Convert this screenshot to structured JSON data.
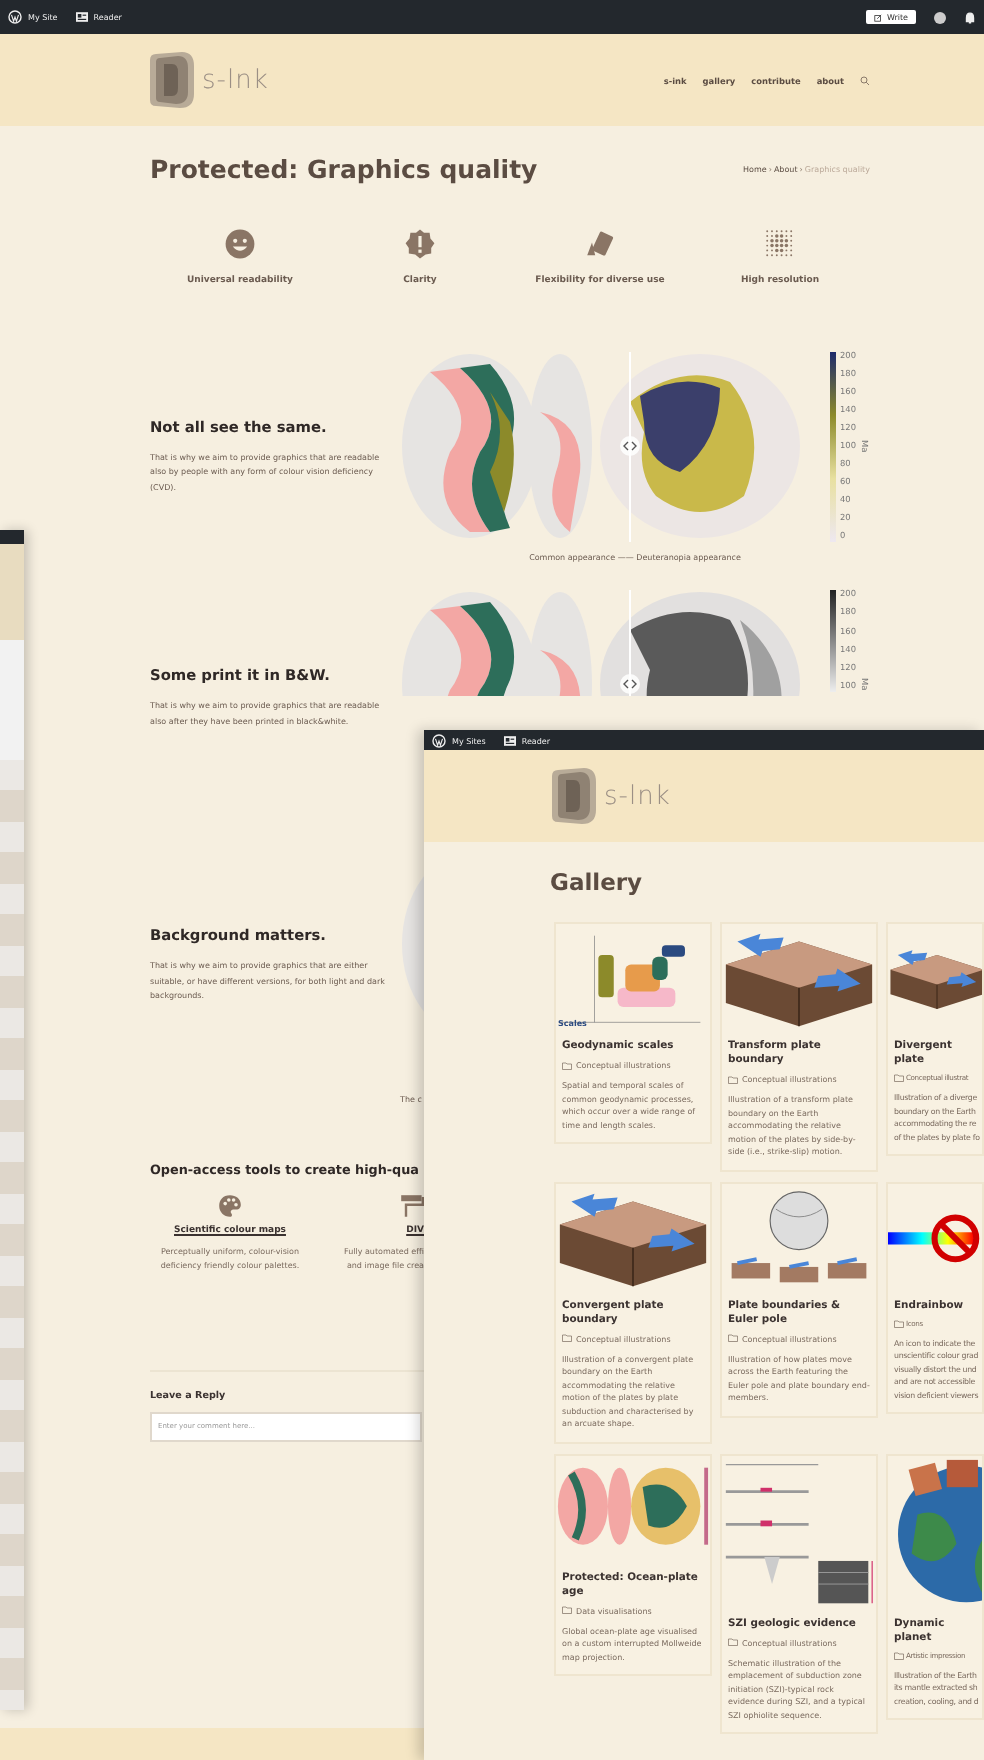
{
  "main_window": {
    "admin_bar": {
      "links": [
        "My Site",
        "Reader"
      ],
      "write_button": "Write"
    },
    "header": {
      "logo_text": "s-lnk",
      "nav": [
        "s-ink",
        "gallery",
        "contribute",
        "about"
      ]
    },
    "title": "Protected: Graphics quality",
    "breadcrumb": {
      "items": [
        "Home",
        "About",
        "Graphics quality"
      ],
      "separator": "›"
    },
    "features": [
      {
        "kind": "smiley",
        "label": "Universal readability"
      },
      {
        "kind": "badge",
        "label": "Clarity"
      },
      {
        "kind": "cards",
        "label": "Flexibility for diverse use"
      },
      {
        "kind": "dots",
        "label": "High resolution"
      }
    ],
    "sections": [
      {
        "heading": "Not all see the same.",
        "text": "That is why we aim to provide graphics that are readable also by people with any form of colour vision deficiency (CVD).",
        "kind": "color",
        "colorbar": {
          "ticks": [
            "200",
            "180",
            "160",
            "140",
            "120",
            "100",
            "80",
            "60",
            "40",
            "20",
            "0"
          ],
          "unit": "Ma"
        },
        "caption": "Common appearance —— Deuteranopia appearance"
      },
      {
        "heading": "Some print it in B&W.",
        "text": "That is why we aim to provide graphics that are readable also after they have been printed in black&white.",
        "kind": "grey",
        "colorbar": {
          "ticks": [
            "200",
            "180",
            "160",
            "140",
            "120",
            "100"
          ],
          "unit": "Ma"
        }
      },
      {
        "heading": "Background matters.",
        "text": "That is why we aim to provide graphics that are either suitable, or have different versions, for both light and dark backgrounds.",
        "kind": "color",
        "caption": "The c"
      }
    ],
    "tools": {
      "heading": "Open-access tools to create high-qua",
      "items": [
        {
          "kind": "palette",
          "title": "Scientific colour maps",
          "lines": [
            "Perceptually uniform, colour-vision",
            "deficiency friendly colour palettes."
          ]
        },
        {
          "kind": "roller",
          "title": "DIV",
          "lines": [
            "Fully automated effi",
            "and image file crea"
          ]
        }
      ]
    },
    "reply": {
      "heading": "Leave a Reply",
      "placeholder": "Enter your comment here..."
    }
  },
  "gallery_window": {
    "admin_bar": {
      "links": [
        "My Sites",
        "Reader"
      ]
    },
    "logo_text": "s-lnk",
    "title": "Gallery",
    "cards": [
      {
        "kind": "scales",
        "image_label": "Scales",
        "title": "Geodynamic scales",
        "category": "Conceptual illustrations",
        "description": "Spatial and temporal scales of common geodynamic processes, which occur over a wide range of time and length scales."
      },
      {
        "kind": "block",
        "title": "Transform plate boundary",
        "category": "Conceptual illustrations",
        "description": "Illustration of a transform plate boundary on the Earth accommodating the relative motion of the plates by side-by-side (i.e., strike-slip) motion."
      },
      {
        "kind": "block",
        "title": "Divergent plate",
        "category": "Conceptual illustrat",
        "description_lines": [
          "Illustration of a diverge",
          "boundary on the Earth",
          "accommodating the re",
          "of the plates by plate fo"
        ]
      },
      {
        "kind": "block",
        "title": "Convergent plate boundary",
        "category": "Conceptual illustrations",
        "description": "Illustration of a convergent plate boundary on the Earth accommodating the relative motion of the plates by plate subduction and characterised by an arcuate shape."
      },
      {
        "kind": "globe",
        "title": "Plate boundaries & Euler pole",
        "category": "Conceptual illustrations",
        "description": "Illustration of how plates move across the Earth featuring the Euler pole and plate boundary end-members."
      },
      {
        "kind": "norainbow",
        "title": "Endrainbow",
        "category": "Icons",
        "description_lines": [
          "An icon to indicate the",
          "unscientific colour grad",
          "visually distort the und",
          "and are not accessible",
          "vision deficient viewers"
        ]
      },
      {
        "kind": "map",
        "title": "Protected: Ocean-plate age",
        "category": "Data visualisations",
        "description": "Global ocean-plate age visualised on a custom interrupted Mollweide map projection."
      },
      {
        "kind": "schematic",
        "title": "SZI geologic evidence",
        "category": "Conceptual illustrations",
        "description": "Schematic illustration of the emplacement of subduction zone initiation (SZI)-typical rock evidence during SZI, and a typical SZI ophiolite sequence."
      },
      {
        "kind": "planet",
        "title": "Dynamic planet",
        "category": "Artistic impression",
        "description_lines": [
          "Illustration of the Earth",
          "its mantle extracted sh",
          "creation, cooling, and d"
        ]
      }
    ]
  }
}
